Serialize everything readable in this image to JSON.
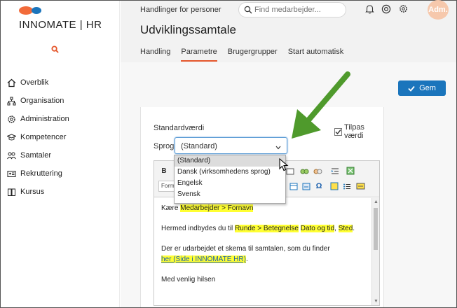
{
  "brand": {
    "name": "INNOMATE | HR",
    "accent": "#e5572c",
    "secondary": "#1b75bc"
  },
  "sidebar": {
    "items": [
      {
        "label": "Overblik",
        "icon": "home-icon"
      },
      {
        "label": "Organisation",
        "icon": "org-chart-icon"
      },
      {
        "label": "Administration",
        "icon": "gear-icon"
      },
      {
        "label": "Kompetencer",
        "icon": "graduation-cap-icon"
      },
      {
        "label": "Samtaler",
        "icon": "people-icon"
      },
      {
        "label": "Rekruttering",
        "icon": "id-card-icon"
      },
      {
        "label": "Kursus",
        "icon": "book-icon"
      }
    ]
  },
  "header": {
    "context": "Handlinger for personer",
    "search_placeholder": "Find medarbejder...",
    "avatar": "Adm.",
    "title": "Udviklingssamtale",
    "tabs": [
      {
        "label": "Handling",
        "active": false
      },
      {
        "label": "Parametre",
        "active": true
      },
      {
        "label": "Brugergrupper",
        "active": false
      },
      {
        "label": "Start automatisk",
        "active": false
      }
    ]
  },
  "actions": {
    "save_label": "Gem"
  },
  "form": {
    "standard_label": "Standardværdi",
    "customize_label": "Tilpas værdi",
    "customize_checked": true,
    "language_label": "Sprog",
    "language_value": "(Standard)",
    "language_options": [
      "(Standard)",
      "Dansk (virksomhedens sprog)",
      "Engelsk",
      "Svensk"
    ]
  },
  "editor": {
    "format_combo": "Form",
    "bold": "B",
    "line1_pre": "Kære ",
    "line1_field": "Medarbejder > Fornavn",
    "line2_pre": "Hermed indbydes du til ",
    "line2_field1": "Runde > Betegnelse",
    "line2_field2": "Dato og tid",
    "line2_sep": ", ",
    "line2_field3": "Sted",
    "line2_end": ".",
    "line3": "Der er udarbejdet et skema til samtalen, som du finder",
    "line4_link": "her (Side i INNOMATE HR)",
    "line4_end": ".",
    "line5": "Med venlig hilsen"
  }
}
